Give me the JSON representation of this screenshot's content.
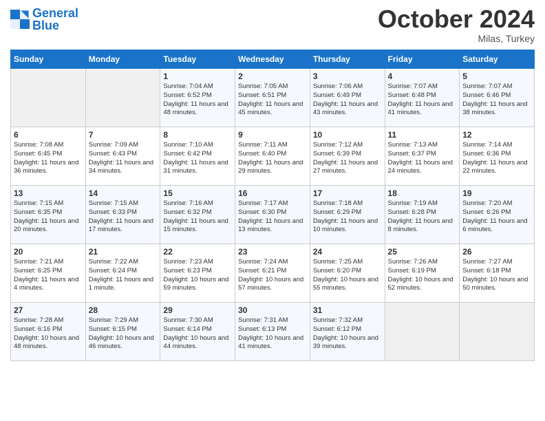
{
  "logo": {
    "line1": "General",
    "line2": "Blue"
  },
  "title": "October 2024",
  "subtitle": "Milas, Turkey",
  "days_of_week": [
    "Sunday",
    "Monday",
    "Tuesday",
    "Wednesday",
    "Thursday",
    "Friday",
    "Saturday"
  ],
  "weeks": [
    [
      {
        "day": "",
        "content": ""
      },
      {
        "day": "",
        "content": ""
      },
      {
        "day": "1",
        "content": "Sunrise: 7:04 AM\nSunset: 6:52 PM\nDaylight: 11 hours and 48 minutes."
      },
      {
        "day": "2",
        "content": "Sunrise: 7:05 AM\nSunset: 6:51 PM\nDaylight: 11 hours and 45 minutes."
      },
      {
        "day": "3",
        "content": "Sunrise: 7:06 AM\nSunset: 6:49 PM\nDaylight: 11 hours and 43 minutes."
      },
      {
        "day": "4",
        "content": "Sunrise: 7:07 AM\nSunset: 6:48 PM\nDaylight: 11 hours and 41 minutes."
      },
      {
        "day": "5",
        "content": "Sunrise: 7:07 AM\nSunset: 6:46 PM\nDaylight: 11 hours and 38 minutes."
      }
    ],
    [
      {
        "day": "6",
        "content": "Sunrise: 7:08 AM\nSunset: 6:45 PM\nDaylight: 11 hours and 36 minutes."
      },
      {
        "day": "7",
        "content": "Sunrise: 7:09 AM\nSunset: 6:43 PM\nDaylight: 11 hours and 34 minutes."
      },
      {
        "day": "8",
        "content": "Sunrise: 7:10 AM\nSunset: 6:42 PM\nDaylight: 11 hours and 31 minutes."
      },
      {
        "day": "9",
        "content": "Sunrise: 7:11 AM\nSunset: 6:40 PM\nDaylight: 11 hours and 29 minutes."
      },
      {
        "day": "10",
        "content": "Sunrise: 7:12 AM\nSunset: 6:39 PM\nDaylight: 11 hours and 27 minutes."
      },
      {
        "day": "11",
        "content": "Sunrise: 7:13 AM\nSunset: 6:37 PM\nDaylight: 11 hours and 24 minutes."
      },
      {
        "day": "12",
        "content": "Sunrise: 7:14 AM\nSunset: 6:36 PM\nDaylight: 11 hours and 22 minutes."
      }
    ],
    [
      {
        "day": "13",
        "content": "Sunrise: 7:15 AM\nSunset: 6:35 PM\nDaylight: 11 hours and 20 minutes."
      },
      {
        "day": "14",
        "content": "Sunrise: 7:15 AM\nSunset: 6:33 PM\nDaylight: 11 hours and 17 minutes."
      },
      {
        "day": "15",
        "content": "Sunrise: 7:16 AM\nSunset: 6:32 PM\nDaylight: 11 hours and 15 minutes."
      },
      {
        "day": "16",
        "content": "Sunrise: 7:17 AM\nSunset: 6:30 PM\nDaylight: 11 hours and 13 minutes."
      },
      {
        "day": "17",
        "content": "Sunrise: 7:18 AM\nSunset: 6:29 PM\nDaylight: 11 hours and 10 minutes."
      },
      {
        "day": "18",
        "content": "Sunrise: 7:19 AM\nSunset: 6:28 PM\nDaylight: 11 hours and 8 minutes."
      },
      {
        "day": "19",
        "content": "Sunrise: 7:20 AM\nSunset: 6:26 PM\nDaylight: 11 hours and 6 minutes."
      }
    ],
    [
      {
        "day": "20",
        "content": "Sunrise: 7:21 AM\nSunset: 6:25 PM\nDaylight: 11 hours and 4 minutes."
      },
      {
        "day": "21",
        "content": "Sunrise: 7:22 AM\nSunset: 6:24 PM\nDaylight: 11 hours and 1 minute."
      },
      {
        "day": "22",
        "content": "Sunrise: 7:23 AM\nSunset: 6:23 PM\nDaylight: 10 hours and 59 minutes."
      },
      {
        "day": "23",
        "content": "Sunrise: 7:24 AM\nSunset: 6:21 PM\nDaylight: 10 hours and 57 minutes."
      },
      {
        "day": "24",
        "content": "Sunrise: 7:25 AM\nSunset: 6:20 PM\nDaylight: 10 hours and 55 minutes."
      },
      {
        "day": "25",
        "content": "Sunrise: 7:26 AM\nSunset: 6:19 PM\nDaylight: 10 hours and 52 minutes."
      },
      {
        "day": "26",
        "content": "Sunrise: 7:27 AM\nSunset: 6:18 PM\nDaylight: 10 hours and 50 minutes."
      }
    ],
    [
      {
        "day": "27",
        "content": "Sunrise: 7:28 AM\nSunset: 6:16 PM\nDaylight: 10 hours and 48 minutes."
      },
      {
        "day": "28",
        "content": "Sunrise: 7:29 AM\nSunset: 6:15 PM\nDaylight: 10 hours and 46 minutes."
      },
      {
        "day": "29",
        "content": "Sunrise: 7:30 AM\nSunset: 6:14 PM\nDaylight: 10 hours and 44 minutes."
      },
      {
        "day": "30",
        "content": "Sunrise: 7:31 AM\nSunset: 6:13 PM\nDaylight: 10 hours and 41 minutes."
      },
      {
        "day": "31",
        "content": "Sunrise: 7:32 AM\nSunset: 6:12 PM\nDaylight: 10 hours and 39 minutes."
      },
      {
        "day": "",
        "content": ""
      },
      {
        "day": "",
        "content": ""
      }
    ]
  ]
}
